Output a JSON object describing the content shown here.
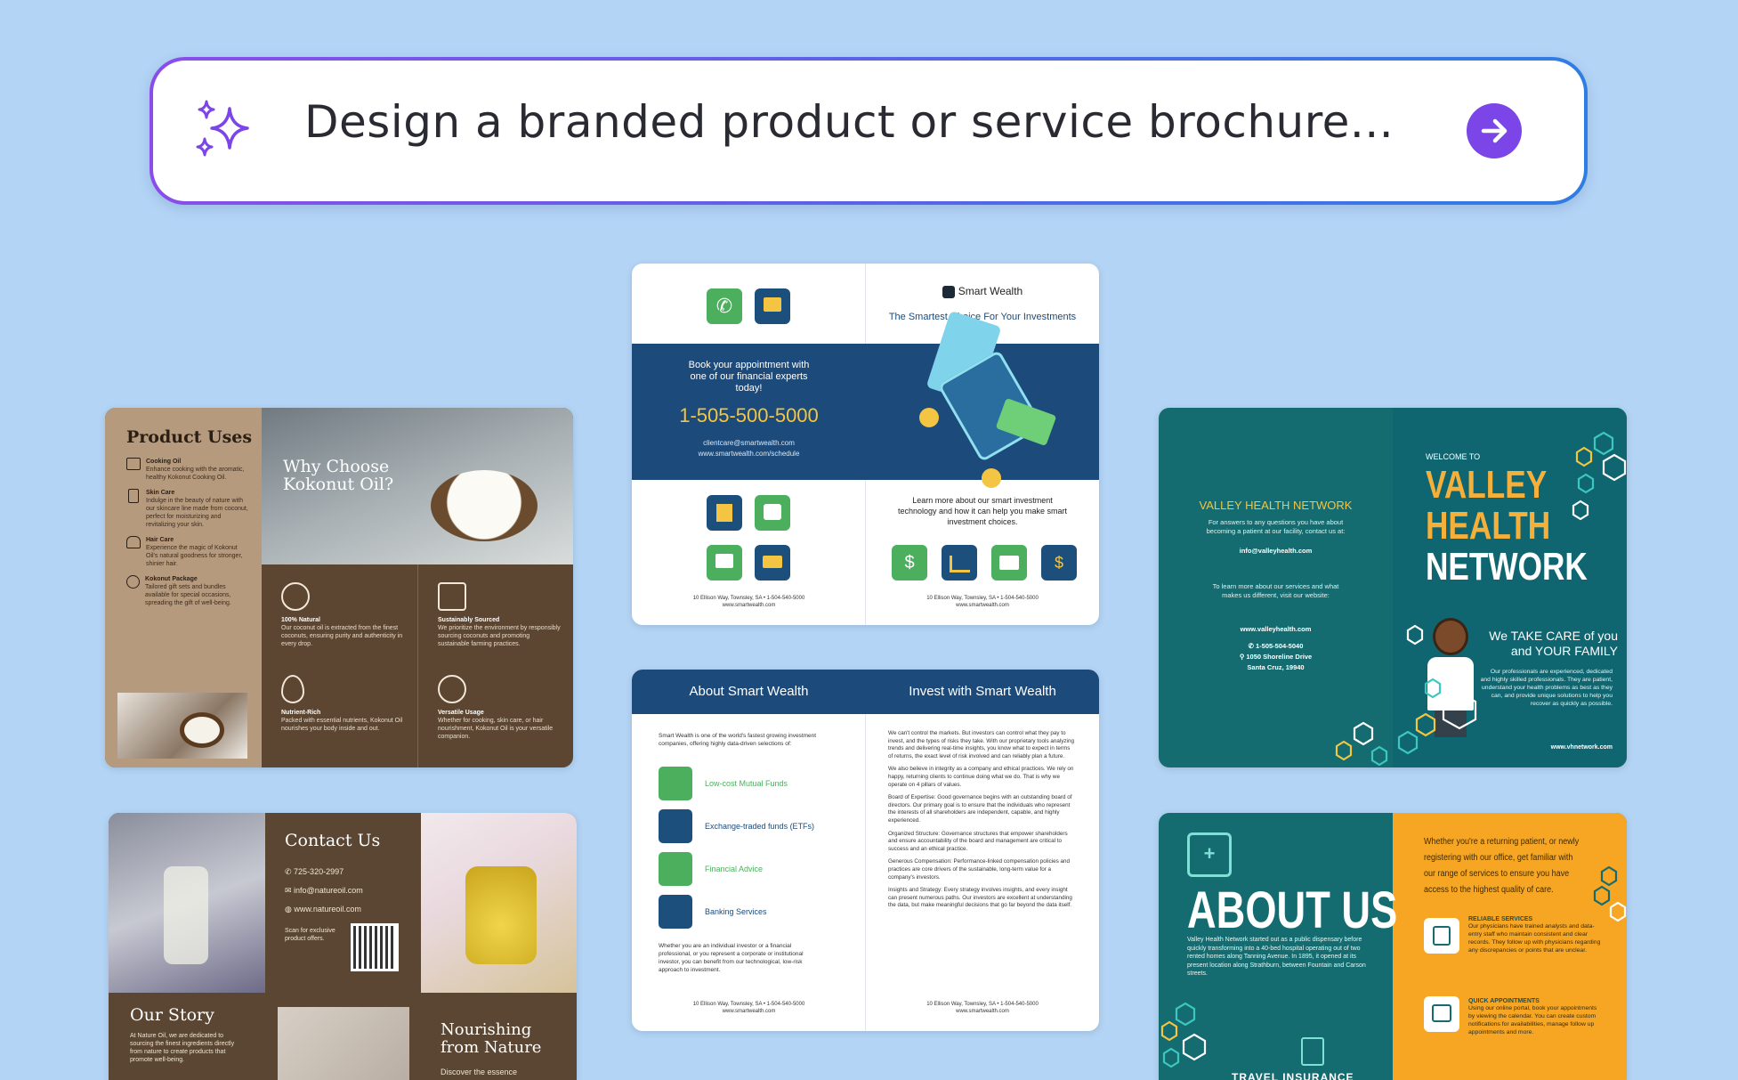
{
  "prompt": {
    "text": "Design a branded product or service brochure...",
    "accent": "#7b45e8"
  },
  "kokonut": {
    "product_uses_title": "Product Uses",
    "uses": [
      {
        "title": "Cooking Oil",
        "text": "Enhance cooking with the aromatic, healthy Kokonut Cooking Oil."
      },
      {
        "title": "Skin Care",
        "text": "Indulge in the beauty of nature with our skincare line made from coconut, perfect for moisturizing and revitalizing your skin."
      },
      {
        "title": "Hair Care",
        "text": "Experience the magic of Kokonut Oil's natural goodness for stronger, shinier hair."
      },
      {
        "title": "Kokonut Package",
        "text": "Tailored gift sets and bundles available for special occasions, spreading the gift of well-being."
      }
    ],
    "why_title": "Why Choose Kokonut Oil?",
    "features": [
      {
        "title": "100% Natural",
        "text": "Our coconut oil is extracted from the finest coconuts, ensuring purity and authenticity in every drop."
      },
      {
        "title": "Sustainably Sourced",
        "text": "We prioritize the environment by responsibly sourcing coconuts and promoting sustainable farming practices."
      },
      {
        "title": "Nutrient-Rich",
        "text": "Packed with essential nutrients, Kokonut Oil nourishes your body inside and out."
      },
      {
        "title": "Versatile Usage",
        "text": "Whether for cooking, skin care, or hair nourishment, Kokonut Oil is your versatile companion."
      }
    ]
  },
  "nature": {
    "contact_title": "Contact Us",
    "phone": "725-320-2997",
    "email": "info@natureoil.com",
    "web": "www.natureoil.com",
    "scan_text": "Scan for exclusive product offers.",
    "story_title": "Our Story",
    "story_text": "At Nature Oil, we are dedicated to sourcing the finest ingredients directly from nature to create products that promote well-being.",
    "nourish_title": "Nourishing from Nature",
    "nourish_text": "Discover the essence"
  },
  "smart": {
    "brand": "Smart Wealth",
    "tagline": "The Smartest Choice For Your Investments",
    "book_text": "Book your appointment with one of our financial experts today!",
    "phone": "1-505-500-5000",
    "email": "clientcare@smartwealth.com",
    "schedule": "www.smartwealth.com/schedule",
    "learn_text": "Learn more about our smart investment technology and how it can help you make smart investment choices.",
    "footer_addr": "10 Ellison Way, Townsley, SA • 1-504-540-5000",
    "footer_web": "www.smartwealth.com",
    "about_title": "About Smart Wealth",
    "invest_title": "Invest with Smart Wealth",
    "about_intro": "Smart Wealth is one of the world's fastest growing investment companies, offering highly data-driven selections of:",
    "services": [
      "Low-cost Mutual Funds",
      "Exchange-traded funds (ETFs)",
      "Financial Advice",
      "Banking Services"
    ],
    "about_outro": "Whether you are an individual investor or a financial professional, or you represent a corporate or institutional investor, you can benefit from our technological, low-risk approach to investment.",
    "invest_paras": [
      "We can't control the markets. But investors can control what they pay to invest, and the types of risks they take. With our proprietary tools analyzing trends and delivering real-time insights, you know what to expect in terms of returns, the exact level of risk involved and can reliably plan a future.",
      "We also believe in integrity as a company and ethical practices. We rely on happy, returning clients to continue doing what we do. That is why we operate on 4 pillars of values.",
      "Board of Expertise: Good governance begins with an outstanding board of directors. Our primary goal is to ensure that the individuals who represent the interests of all shareholders are independent, capable, and highly experienced.",
      "Organized Structure: Governance structures that empower shareholders and ensure accountability of the board and management are critical to success and an ethical practice.",
      "Generous Compensation: Performance-linked compensation policies and practices are core drivers of the sustainable, long-term value for a company's investors.",
      "Insights and Strategy: Every strategy involves insights, and every insight can present numerous paths. Our investors are excellent at understanding the data, but make meaningful decisions that go far beyond the data itself."
    ]
  },
  "valley": {
    "small_title_1": "VALLEY",
    "small_title_2": "HEALTH NETWORK",
    "questions": "For answers to any questions you have about becoming a patient at our facility, contact us at:",
    "email": "info@valleyhealth.com",
    "learn": "To learn more about our services and what makes us different, visit our website:",
    "web": "www.valleyhealth.com",
    "phone": "1-505-504-5040",
    "addr1": "1050 Shoreline Drive",
    "addr2": "Santa Cruz, 19940",
    "welcome": "WELCOME TO",
    "big1": "VALLEY",
    "big2": "HEALTH",
    "big3": "NETWORK",
    "care1": "We TAKE CARE of you",
    "care2": "and YOUR FAMILY",
    "care_text": "Our professionals are experienced, dedicated and highly skilled professionals. They are patient, understand your health problems as best as they can, and provide unique solutions to help you recover as quickly as possible.",
    "vhn_web": "www.vhnetwork.com",
    "about_title": "ABOUT US",
    "about_text": "Valley Health Network started out as a public dispensary before quickly transforming into a 40-bed hospital operating out of two rented homes along Tanning Avenue. In 1895, it opened at its present location along Strathburn, between Fountain and Carson streets.",
    "returning": "Whether you're a returning patient, or newly registering with our office, get familiar with our range of services to ensure you have access to the highest quality of care.",
    "svc1_title": "RELIABLE SERVICES",
    "svc1_text": "Our physicians have trained analysts and data-entry staff who maintain consistent and clear records. They follow up with physicians regarding any discrepancies or points that are unclear.",
    "svc2_title": "QUICK APPOINTMENTS",
    "svc2_text": "Using our online portal, book your appointments by viewing the calendar. You can create custom notifications for availabilities, manage follow up appointments and more.",
    "travel": "TRAVEL INSURANCE"
  }
}
